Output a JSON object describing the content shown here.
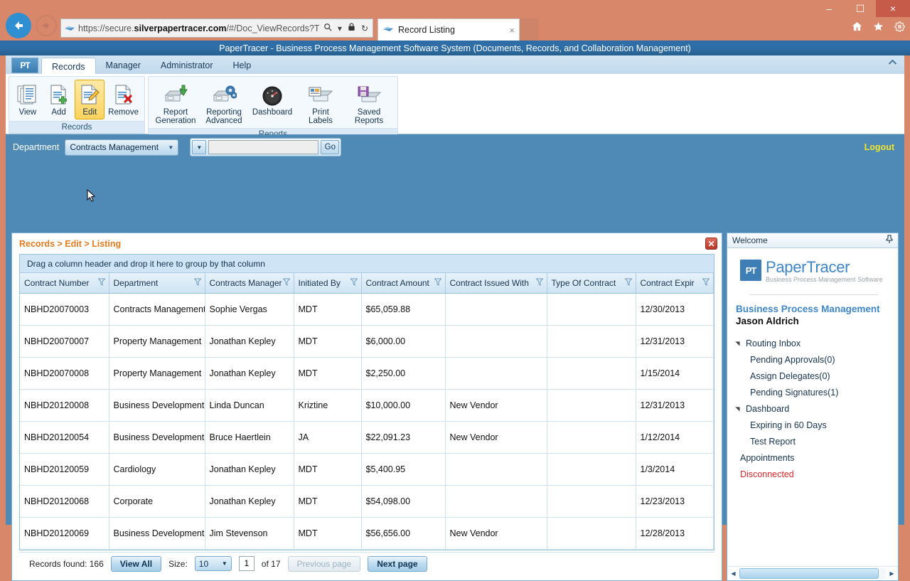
{
  "browser": {
    "url_prefix": "https://secure.",
    "url_bold": "silverpapertracer.com",
    "url_suffix": "/#/Doc_ViewRecords?Type=Ed",
    "search_icon": "search-icon",
    "dropdown_icon": "chevron-down-icon",
    "lock_icon": "lock-icon",
    "refresh_icon": "refresh-icon",
    "tab_title": "Record Listing",
    "tab_close": "×",
    "minimize": "–",
    "maximize": "☐",
    "close": "×",
    "home_icon": "⌂",
    "favorites_icon": "★",
    "settings_icon": "⚙",
    "back_arrow": "←",
    "forward_arrow": "→"
  },
  "app": {
    "title": "PaperTracer - Business Process Management Software System (Documents, Records, and Collaboration Management)",
    "logo_text": "PT",
    "collapse_icon": "chevron-up-icon"
  },
  "ribbon": {
    "tabs": [
      {
        "label": "Records",
        "active": true
      },
      {
        "label": "Manager",
        "active": false
      },
      {
        "label": "Administrator",
        "active": false
      },
      {
        "label": "Help",
        "active": false
      }
    ],
    "groups": [
      {
        "label": "Records",
        "buttons": [
          {
            "label": "View",
            "icon": "documents-stack-icon",
            "selected": false
          },
          {
            "label": "Add",
            "icon": "document-add-icon",
            "selected": false
          },
          {
            "label": "Edit",
            "icon": "document-edit-icon",
            "selected": true
          },
          {
            "label": "Remove",
            "icon": "document-delete-icon",
            "selected": false
          }
        ]
      },
      {
        "label": "Reports",
        "buttons": [
          {
            "label": "Report\nGeneration",
            "icon": "report-generation-icon",
            "selected": false
          },
          {
            "label": "Reporting\nAdvanced",
            "icon": "reporting-advanced-icon",
            "selected": false
          },
          {
            "label": "Dashboard",
            "icon": "dashboard-gauge-icon",
            "selected": false
          },
          {
            "label": "Print\nLabels",
            "icon": "print-labels-icon",
            "selected": false
          },
          {
            "label": "Saved\nReports",
            "icon": "saved-reports-icon",
            "selected": false
          }
        ]
      }
    ]
  },
  "deptbar": {
    "label": "Department",
    "selected_department": "Contracts Management",
    "search_value": "",
    "search_placeholder": "",
    "go_label": "Go",
    "logout_label": "Logout"
  },
  "panel": {
    "breadcrumb": "Records > Edit > Listing",
    "close_icon": "close-icon",
    "group_hint": "Drag a column header and drop it here to group by that column"
  },
  "grid": {
    "columns": [
      "Contract Number",
      "Department",
      "Contracts Manager",
      "Initiated By",
      "Contract Amount",
      "Contract Issued With",
      "Type Of Contract",
      "Contract Expir"
    ],
    "rows": [
      [
        "NBHD20070003",
        "Contracts Management",
        "Sophie Vergas",
        "MDT",
        "$65,059.88",
        "",
        "",
        "12/30/2013"
      ],
      [
        "NBHD20070007",
        "Property Management",
        "Jonathan Kepley",
        "MDT",
        "$6,000.00",
        "",
        "",
        "12/31/2013"
      ],
      [
        "NBHD20070008",
        "Property Management",
        "Jonathan Kepley",
        "MDT",
        "$2,250.00",
        "",
        "",
        "1/15/2014"
      ],
      [
        "NBHD20120008",
        "Business Development",
        "Linda Duncan",
        "Kriztine",
        "$10,000.00",
        "New Vendor",
        "",
        "12/31/2013"
      ],
      [
        "NBHD20120054",
        "Business Development",
        "Bruce Haertlein",
        "JA",
        "$22,091.23",
        "New Vendor",
        "",
        "1/12/2014"
      ],
      [
        "NBHD20120059",
        "Cardiology",
        "Jonathan Kepley",
        "MDT",
        "$5,400.95",
        "",
        "",
        "1/3/2014"
      ],
      [
        "NBHD20120068",
        "Corporate",
        "Jonathan Kepley",
        "MDT",
        "$54,098.00",
        "",
        "",
        "12/23/2013"
      ],
      [
        "NBHD20120069",
        "Business Development",
        "Jim Stevenson",
        "MDT",
        "$56,656.00",
        "New Vendor",
        "",
        "12/28/2013"
      ]
    ]
  },
  "footer": {
    "records_found": "Records found: 166",
    "view_all": "View All",
    "size_label": "Size:",
    "size_value": "10",
    "page_value": "1",
    "of_text": "of 17",
    "previous_page": "Previous page",
    "next_page": "Next page"
  },
  "sidebar": {
    "header": "Welcome",
    "pin_icon": "pin-icon",
    "brand_mark": "PT",
    "brand_name": "PaperTracer",
    "brand_sub": "Business Process Management Software",
    "heading": "Business Process Management",
    "user": "Jason Aldrich",
    "items": [
      {
        "label": "Routing Inbox",
        "type": "group"
      },
      {
        "label": "Pending Approvals(0)",
        "type": "child"
      },
      {
        "label": "Assign Delegates(0)",
        "type": "child"
      },
      {
        "label": "Pending Signatures(1)",
        "type": "child"
      },
      {
        "label": "Dashboard",
        "type": "group"
      },
      {
        "label": "Expiring in 60 Days",
        "type": "child"
      },
      {
        "label": "Test Report",
        "type": "child"
      },
      {
        "label": "Appointments",
        "type": "plain"
      },
      {
        "label": "Disconnected",
        "type": "disconnected"
      }
    ]
  },
  "colors": {
    "accent_orange": "#e07b1f",
    "brand_blue": "#3f86c4",
    "logout_yellow": "#f2e52f",
    "disconnected_red": "#d42a2a",
    "chrome_bg": "#d9876a"
  }
}
